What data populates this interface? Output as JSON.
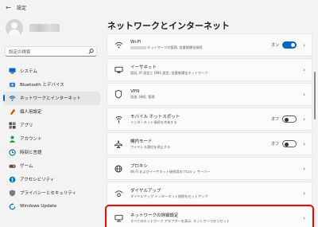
{
  "window": {
    "title": "設定"
  },
  "sidebar": {
    "search_placeholder": "設定の検索",
    "items": [
      {
        "label": "システム",
        "icon": "system-icon",
        "color": "#0067c0"
      },
      {
        "label": "Bluetooth とデバイス",
        "icon": "bluetooth-icon",
        "color": "#0a5fb4"
      },
      {
        "label": "ネットワークとインターネット",
        "icon": "network-icon",
        "color": "#0a5fb4",
        "active": true
      },
      {
        "label": "個人用設定",
        "icon": "personalization-icon",
        "color": "#c15c00"
      },
      {
        "label": "アプリ",
        "icon": "apps-icon",
        "color": "#4a4a4a"
      },
      {
        "label": "アカウント",
        "icon": "account-icon",
        "color": "#2a9d3a"
      },
      {
        "label": "時刻と言語",
        "icon": "time-language-icon",
        "color": "#0067c0"
      },
      {
        "label": "ゲーム",
        "icon": "gaming-icon",
        "color": "#555555"
      },
      {
        "label": "アクセシビリティ",
        "icon": "accessibility-icon",
        "color": "#0067c0"
      },
      {
        "label": "プライバシーとセキュリティ",
        "icon": "shield-icon",
        "color": "#6b6b6b"
      },
      {
        "label": "Windows Update",
        "icon": "windows-update-icon",
        "color": "#0067c0"
      }
    ]
  },
  "main": {
    "title": "ネットワークとインターネット",
    "cards": [
      {
        "title": "Wi-Fi",
        "desc": "ネットワークの管理, 従量制課金接続",
        "icon": "wifi-icon",
        "toggle": "on",
        "state_label": "オン"
      },
      {
        "title": "イーサネット",
        "desc": "認証, IP 設定と DNS 設定, 従量制課金ネットワーク",
        "icon": "ethernet-icon"
      },
      {
        "title": "VPN",
        "desc": "追加, 接続, 管理",
        "icon": "vpn-icon"
      },
      {
        "title": "モバイル ホットスポット",
        "desc": "インターネット接続を共有する",
        "icon": "hotspot-icon",
        "toggle": "off",
        "state_label": "オフ"
      },
      {
        "title": "機内モード",
        "desc": "ワイヤレス通信を停止する",
        "icon": "airplane-icon",
        "toggle": "off",
        "state_label": "オフ"
      },
      {
        "title": "プロキシ",
        "desc": "Wi-Fi およびイーサネット接続用のプロキシ サーバー",
        "icon": "proxy-icon"
      },
      {
        "title": "ダイヤルアップ",
        "desc": "ダイヤルアップ インターネット接続をセットアップ",
        "icon": "dialup-icon"
      },
      {
        "title": "ネットワークの詳細設定",
        "desc": "すべてのネットワーク アダプターを表示, ネットワークのリセット",
        "icon": "advanced-network-icon",
        "highlight": true,
        "highlight_color": "#e01010"
      }
    ]
  }
}
